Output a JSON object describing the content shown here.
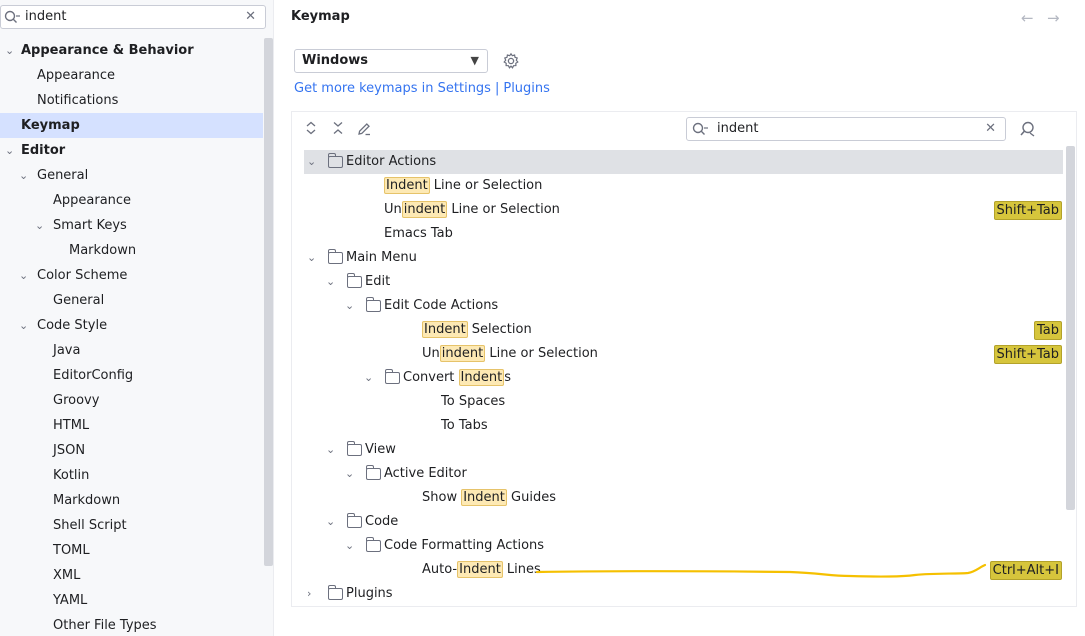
{
  "sidebar": {
    "search_value": "indent",
    "items": [
      {
        "label": "Appearance & Behavior",
        "bold": true,
        "chevron": "v",
        "level": 0
      },
      {
        "label": "Appearance",
        "level": 1
      },
      {
        "label": "Notifications",
        "level": 1
      },
      {
        "label": "Keymap",
        "bold": true,
        "selected": true,
        "level": 0
      },
      {
        "label": "Editor",
        "bold": true,
        "chevron": "v",
        "level": 0
      },
      {
        "label": "General",
        "chevron": "v",
        "level": 1
      },
      {
        "label": "Appearance",
        "level": 2
      },
      {
        "label": "Smart Keys",
        "chevron": "v",
        "level": 2
      },
      {
        "label": "Markdown",
        "level": 3
      },
      {
        "label": "Color Scheme",
        "chevron": "v",
        "level": 1
      },
      {
        "label": "General",
        "level": 2
      },
      {
        "label": "Code Style",
        "chevron": "v",
        "level": 1
      },
      {
        "label": "Java",
        "level": 2
      },
      {
        "label": "EditorConfig",
        "level": 2
      },
      {
        "label": "Groovy",
        "level": 2
      },
      {
        "label": "HTML",
        "level": 2
      },
      {
        "label": "JSON",
        "level": 2
      },
      {
        "label": "Kotlin",
        "level": 2
      },
      {
        "label": "Markdown",
        "level": 2
      },
      {
        "label": "Shell Script",
        "level": 2
      },
      {
        "label": "TOML",
        "level": 2
      },
      {
        "label": "XML",
        "level": 2
      },
      {
        "label": "YAML",
        "level": 2
      },
      {
        "label": "Other File Types",
        "level": 2
      }
    ]
  },
  "main": {
    "title": "Keymap",
    "keymap_value": "Windows",
    "link_more": "Get more keymaps in Settings",
    "link_sep": "|",
    "link_plugins": "Plugins",
    "filter_value": "indent"
  },
  "keymap_tree": [
    {
      "parts": [
        {
          "t": "Editor Actions"
        }
      ],
      "folder": true,
      "chevron": "v",
      "level": 0,
      "highlight": true
    },
    {
      "parts": [
        {
          "t": "Indent",
          "m": true
        },
        {
          "t": " Line or Selection"
        }
      ],
      "level": 1
    },
    {
      "parts": [
        {
          "t": "Un"
        },
        {
          "t": "indent",
          "m": true
        },
        {
          "t": " Line or Selection"
        }
      ],
      "level": 1,
      "shortcut": "Shift+Tab"
    },
    {
      "parts": [
        {
          "t": "Emacs Tab"
        }
      ],
      "level": 1
    },
    {
      "parts": [
        {
          "t": "Main Menu"
        }
      ],
      "folder": true,
      "chevron": "v",
      "level": 0
    },
    {
      "parts": [
        {
          "t": "Edit"
        }
      ],
      "folder": true,
      "chevron": "v",
      "level": 1
    },
    {
      "parts": [
        {
          "t": "Edit Code Actions"
        }
      ],
      "folder": true,
      "chevron": "v",
      "level": 2
    },
    {
      "parts": [
        {
          "t": "Indent",
          "m": true
        },
        {
          "t": " Selection"
        }
      ],
      "level": 3,
      "shortcut": "Tab"
    },
    {
      "parts": [
        {
          "t": "Un"
        },
        {
          "t": "indent",
          "m": true
        },
        {
          "t": " Line or Selection"
        }
      ],
      "level": 3,
      "shortcut": "Shift+Tab"
    },
    {
      "parts": [
        {
          "t": "Convert "
        },
        {
          "t": "Indent",
          "m": true
        },
        {
          "t": "s"
        }
      ],
      "folder": true,
      "chevron": "v",
      "level": 3
    },
    {
      "parts": [
        {
          "t": "To Spaces"
        }
      ],
      "level": 4
    },
    {
      "parts": [
        {
          "t": "To Tabs"
        }
      ],
      "level": 4
    },
    {
      "parts": [
        {
          "t": "View"
        }
      ],
      "folder": true,
      "chevron": "v",
      "level": 1
    },
    {
      "parts": [
        {
          "t": "Active Editor"
        }
      ],
      "folder": true,
      "chevron": "v",
      "level": 2
    },
    {
      "parts": [
        {
          "t": "Show "
        },
        {
          "t": "Indent",
          "m": true
        },
        {
          "t": " Guides"
        }
      ],
      "level": 3
    },
    {
      "parts": [
        {
          "t": "Code"
        }
      ],
      "folder": true,
      "chevron": "v",
      "level": 1
    },
    {
      "parts": [
        {
          "t": "Code Formatting Actions"
        }
      ],
      "folder": true,
      "chevron": "v",
      "level": 2
    },
    {
      "parts": [
        {
          "t": "Auto-"
        },
        {
          "t": "Indent",
          "m": true
        },
        {
          "t": " Lines"
        }
      ],
      "level": 3,
      "shortcut": "Ctrl+Alt+I"
    },
    {
      "parts": [
        {
          "t": "Plugins"
        }
      ],
      "folder": true,
      "chevron": ">",
      "level": 0
    }
  ],
  "colors": {
    "accent_link": "#3574f0",
    "selection": "#d5e1ff",
    "match_highlight": "#fde9b4",
    "shortcut_badge": "#d6c53c",
    "annotation_stroke": "#f5c000"
  }
}
